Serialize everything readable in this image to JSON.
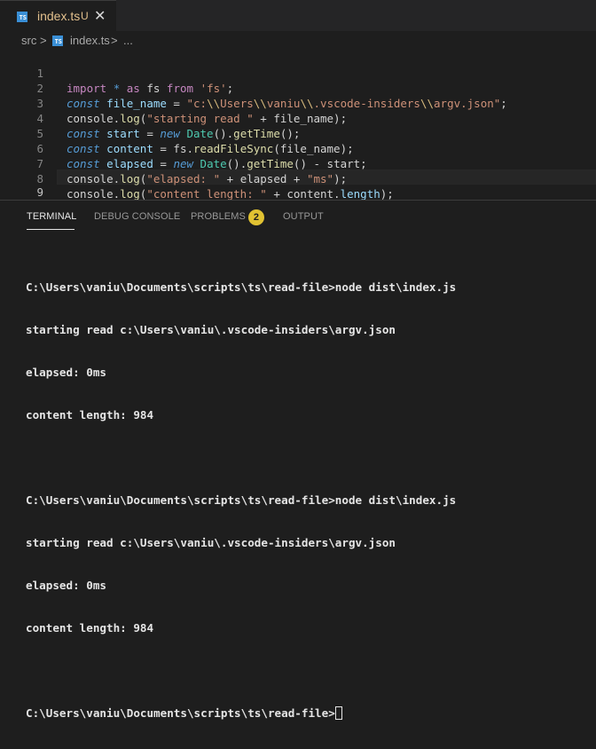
{
  "tab": {
    "filename": "index.ts",
    "status": "U",
    "close": "✕",
    "icon": "ts-file-icon",
    "icon_text": "TS"
  },
  "breadcrumb": {
    "folder": "src",
    "sep": ">",
    "file": "index.ts",
    "more": "..."
  },
  "editor": {
    "line_numbers": [
      "1",
      "2",
      "3",
      "4",
      "5",
      "6",
      "7",
      "8",
      "9"
    ],
    "active_line": "9"
  },
  "panel": {
    "tabs": [
      "TERMINAL",
      "DEBUG CONSOLE",
      "PROBLEMS",
      "OUTPUT"
    ],
    "active_tab": "TERMINAL",
    "problems_count": "2"
  },
  "terminal": {
    "lines": [
      "C:\\Users\\vaniu\\Documents\\scripts\\ts\\read-file>node dist\\index.js",
      "starting read c:\\Users\\vaniu\\.vscode-insiders\\argv.json",
      "elapsed: 0ms",
      "content length: 984",
      "",
      "C:\\Users\\vaniu\\Documents\\scripts\\ts\\read-file>node dist\\index.js",
      "starting read c:\\Users\\vaniu\\.vscode-insiders\\argv.json",
      "elapsed: 0ms",
      "content length: 984",
      ""
    ],
    "prompt": "C:\\Users\\vaniu\\Documents\\scripts\\ts\\read-file>"
  },
  "colors": {
    "accent": "#e2c08d",
    "badge": "#e1c232",
    "background": "#1e1e1e"
  }
}
